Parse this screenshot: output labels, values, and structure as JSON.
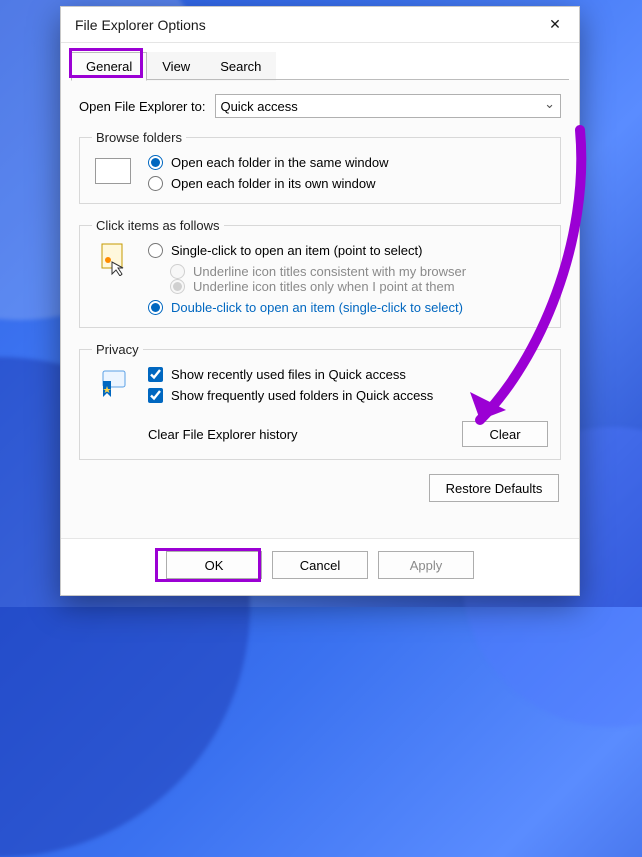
{
  "title": "File Explorer Options",
  "tabs": {
    "general": "General",
    "view": "View",
    "search": "Search"
  },
  "open_to": {
    "label": "Open File Explorer to:",
    "value": "Quick access"
  },
  "browse": {
    "legend": "Browse folders",
    "same": "Open each folder in the same window",
    "own": "Open each folder in its own window"
  },
  "click": {
    "legend": "Click items as follows",
    "single": "Single-click to open an item (point to select)",
    "u_browser": "Underline icon titles consistent with my browser",
    "u_point": "Underline icon titles only when I point at them",
    "double": "Double-click to open an item (single-click to select)"
  },
  "privacy": {
    "legend": "Privacy",
    "recent": "Show recently used files in Quick access",
    "frequent": "Show frequently used folders in Quick access",
    "clear_label": "Clear File Explorer history",
    "clear_btn": "Clear"
  },
  "restore": "Restore Defaults",
  "footer": {
    "ok": "OK",
    "cancel": "Cancel",
    "apply": "Apply"
  }
}
